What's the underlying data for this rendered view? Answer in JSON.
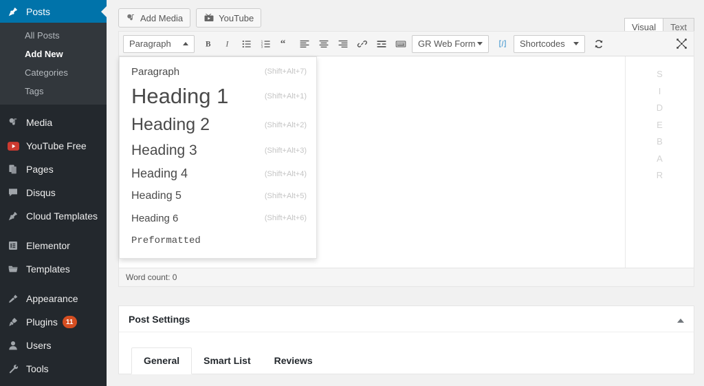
{
  "sidebar": {
    "top_item": {
      "label": "Posts",
      "icon": "pin-icon"
    },
    "submenu": [
      {
        "label": "All Posts",
        "current": false
      },
      {
        "label": "Add New",
        "current": true
      },
      {
        "label": "Categories",
        "current": false
      },
      {
        "label": "Tags",
        "current": false
      }
    ],
    "items": [
      {
        "label": "Media",
        "icon": "media-icon",
        "badge": ""
      },
      {
        "label": "YouTube Free",
        "icon": "youtube-icon",
        "badge": ""
      },
      {
        "label": "Pages",
        "icon": "pages-icon",
        "badge": ""
      },
      {
        "label": "Disqus",
        "icon": "comment-icon",
        "badge": ""
      },
      {
        "label": "Cloud Templates",
        "icon": "pin-icon",
        "badge": ""
      },
      {
        "label": "Elementor",
        "icon": "elementor-icon",
        "badge": ""
      },
      {
        "label": "Templates",
        "icon": "folder-icon",
        "badge": ""
      },
      {
        "label": "Appearance",
        "icon": "brush-icon",
        "badge": ""
      },
      {
        "label": "Plugins",
        "icon": "plug-icon",
        "badge": "11"
      },
      {
        "label": "Users",
        "icon": "user-icon",
        "badge": ""
      },
      {
        "label": "Tools",
        "icon": "wrench-icon",
        "badge": ""
      }
    ],
    "accent_color": "#0073aa",
    "bg_color": "#23282d",
    "submenu_bg_color": "#32373c",
    "badge_color": "#d54e21"
  },
  "editor": {
    "media_buttons": [
      {
        "label": "Add Media",
        "icon": "add-media-icon"
      },
      {
        "label": "YouTube",
        "icon": "youtube-tv-icon"
      }
    ],
    "mode_tabs": [
      {
        "label": "Visual",
        "active": true
      },
      {
        "label": "Text",
        "active": false
      }
    ],
    "format_select": {
      "value": "Paragraph",
      "state": "open"
    },
    "toolbar_icons": [
      "bold-icon",
      "italic-icon",
      "bulleted-list-icon",
      "numbered-list-icon",
      "blockquote-icon",
      "align-left-icon",
      "align-center-icon",
      "align-right-icon",
      "link-icon",
      "read-more-icon",
      "keyboard-shortcuts-icon"
    ],
    "gr_web_form": {
      "label": "GR Web Form"
    },
    "code_icon": "code-brackets-icon",
    "shortcodes": {
      "label": "Shortcodes"
    },
    "refresh_icon": "refresh-icon",
    "fullscreen_icon": "distraction-free-icon",
    "sidebar_vertical_label": "SIDEBAR",
    "word_count": "Word count: 0"
  },
  "format_menu": {
    "items": [
      {
        "label": "Paragraph",
        "shortcut": "(Shift+Alt+7)",
        "style": "fmt-p"
      },
      {
        "label": "Heading 1",
        "shortcut": "(Shift+Alt+1)",
        "style": "fmt-h1"
      },
      {
        "label": "Heading 2",
        "shortcut": "(Shift+Alt+2)",
        "style": "fmt-h2"
      },
      {
        "label": "Heading 3",
        "shortcut": "(Shift+Alt+3)",
        "style": "fmt-h3"
      },
      {
        "label": "Heading 4",
        "shortcut": "(Shift+Alt+4)",
        "style": "fmt-h4"
      },
      {
        "label": "Heading 5",
        "shortcut": "(Shift+Alt+5)",
        "style": "fmt-h5"
      },
      {
        "label": "Heading 6",
        "shortcut": "(Shift+Alt+6)",
        "style": "fmt-h6"
      },
      {
        "label": "Preformatted",
        "shortcut": "",
        "style": "fmt-pre"
      }
    ]
  },
  "post_settings": {
    "title": "Post Settings",
    "toggle_icon": "triangle-up-icon",
    "tabs": [
      {
        "label": "General",
        "active": true
      },
      {
        "label": "Smart List",
        "active": false
      },
      {
        "label": "Reviews",
        "active": false
      }
    ]
  }
}
